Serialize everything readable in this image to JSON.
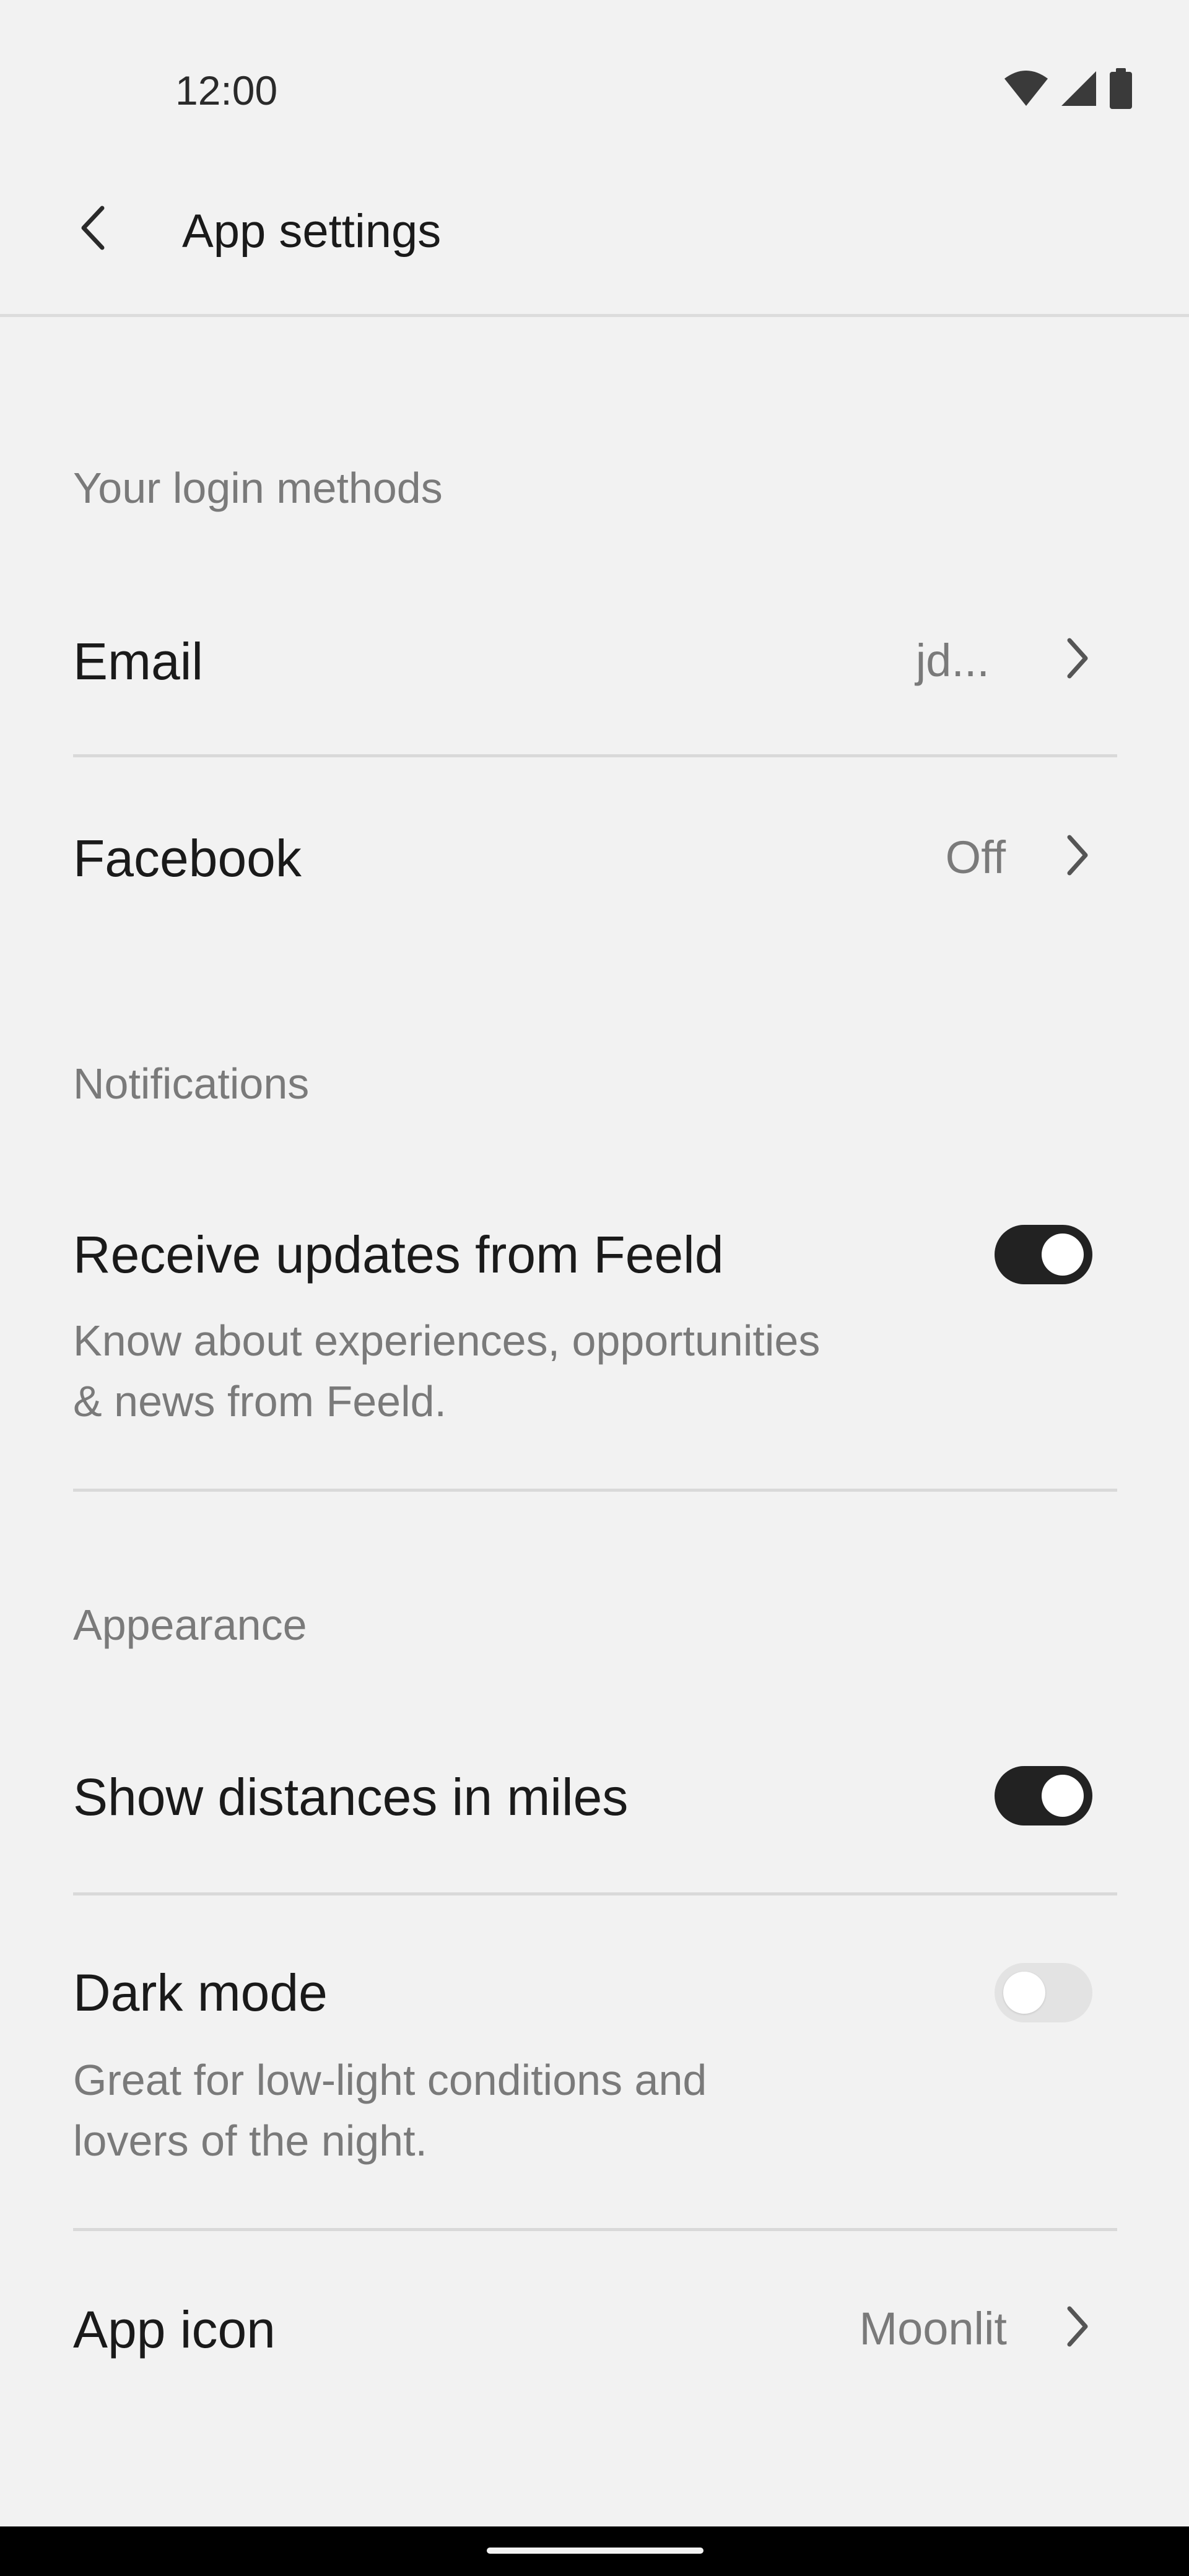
{
  "status_bar": {
    "time": "12:00",
    "icons": [
      "wifi-icon",
      "signal-icon",
      "battery-icon"
    ]
  },
  "app_bar": {
    "back_icon": "chevron-left-icon",
    "title": "App settings"
  },
  "login": {
    "header": "Your login methods",
    "email": {
      "label": "Email",
      "value": "jd...",
      "icon": "chevron-right-icon"
    },
    "facebook": {
      "label": "Facebook",
      "value": "Off",
      "icon": "chevron-right-icon"
    }
  },
  "notifications": {
    "header": "Notifications",
    "updates": {
      "label": "Receive updates from Feeld",
      "description_line1": "Know about experiences, opportunities",
      "description_line2": "& news from Feeld.",
      "enabled": true
    }
  },
  "appearance": {
    "header": "Appearance",
    "miles": {
      "label": "Show distances in miles",
      "enabled": true
    },
    "dark_mode": {
      "label": "Dark mode",
      "description_line1": "Great for low-light conditions and",
      "description_line2": "lovers of the night.",
      "enabled": false
    },
    "app_icon": {
      "label": "App icon",
      "value": "Moonlit",
      "icon": "chevron-right-icon"
    }
  },
  "colors": {
    "background": "#f2f2f2",
    "toggle_on": "#222222",
    "toggle_off": "#e3e3e3",
    "secondary_text": "#7a7a7a"
  }
}
